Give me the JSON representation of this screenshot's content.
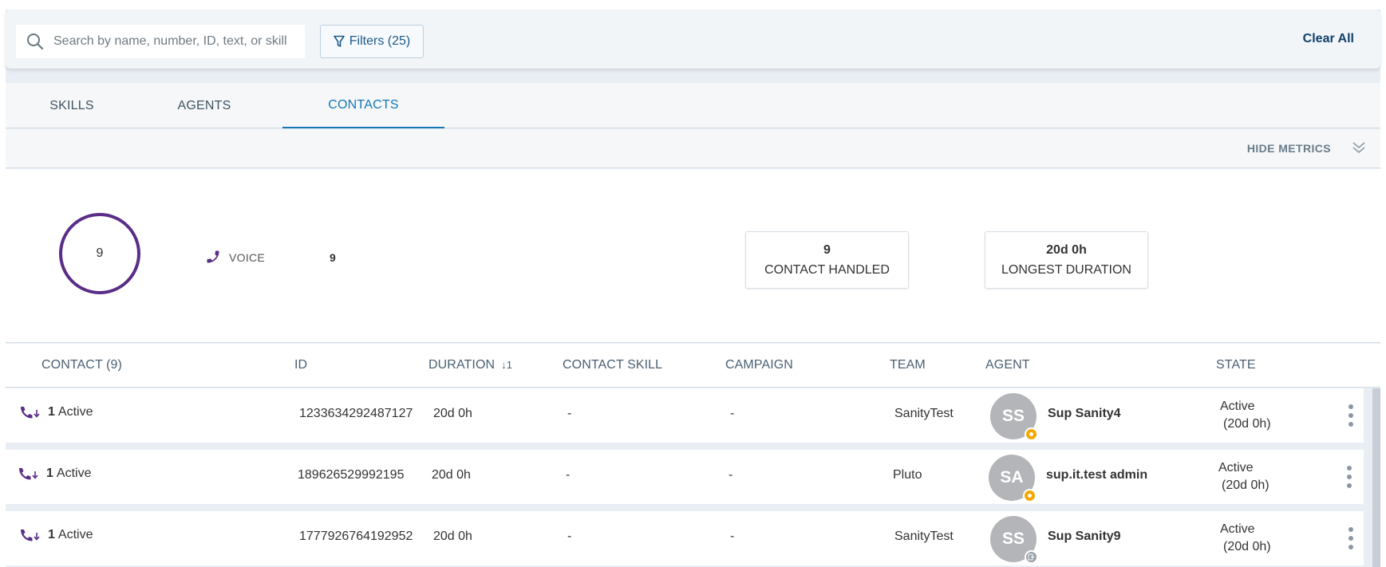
{
  "filterbar": {
    "search_placeholder": "Search by name, number, ID, text, or skill",
    "filters_label": "Filters (25)",
    "clear_all_label": "Clear All"
  },
  "tabs": [
    {
      "label": "SKILLS",
      "active": false
    },
    {
      "label": "AGENTS",
      "active": false
    },
    {
      "label": "CONTACTS",
      "active": true
    }
  ],
  "metrics_bar": {
    "hide_metrics_label": "HIDE METRICS"
  },
  "metrics": {
    "total": "9",
    "channels": [
      {
        "icon": "phone-icon",
        "label": "VOICE",
        "count": "9"
      }
    ],
    "cards": [
      {
        "value": "9",
        "label": "CONTACT HANDLED"
      },
      {
        "value": "20d 0h",
        "label": "LONGEST DURATION"
      }
    ]
  },
  "table": {
    "columns": {
      "contact": "CONTACT (9)",
      "id": "ID",
      "duration": "DURATION",
      "duration_sort": "↓1",
      "contact_skill": "CONTACT SKILL",
      "campaign": "CAMPAIGN",
      "team": "TEAM",
      "agent": "AGENT",
      "state": "STATE"
    },
    "rows": [
      {
        "count": "1",
        "status": "Active",
        "id": "1233634292487127",
        "duration": "20d 0h",
        "contact_skill": "-",
        "campaign": "-",
        "team": "SanityTest",
        "agent_initials": "SS",
        "agent_name": "Sup Sanity4",
        "agent_presence": "away",
        "state": "Active",
        "state_duration": "(20d 0h)"
      },
      {
        "count": "1",
        "status": "Active",
        "id": "189626529992195",
        "duration": "20d 0h",
        "contact_skill": "-",
        "campaign": "-",
        "team": "Pluto",
        "agent_initials": "SA",
        "agent_name": "sup.it.test admin",
        "agent_presence": "away",
        "state": "Active",
        "state_duration": "(20d 0h)"
      },
      {
        "count": "1",
        "status": "Active",
        "id": "1777926764192952",
        "duration": "20d 0h",
        "contact_skill": "-",
        "campaign": "-",
        "team": "SanityTest",
        "agent_initials": "SS",
        "agent_name": "Sup Sanity9",
        "agent_presence": "logged-out",
        "state": "Active",
        "state_duration": "(20d 0h)"
      }
    ]
  },
  "colors": {
    "accent": "#1677b7",
    "voice_purple": "#5a2d87",
    "presence_away": "#f5a800",
    "presence_logout": "#9aa0a6"
  }
}
